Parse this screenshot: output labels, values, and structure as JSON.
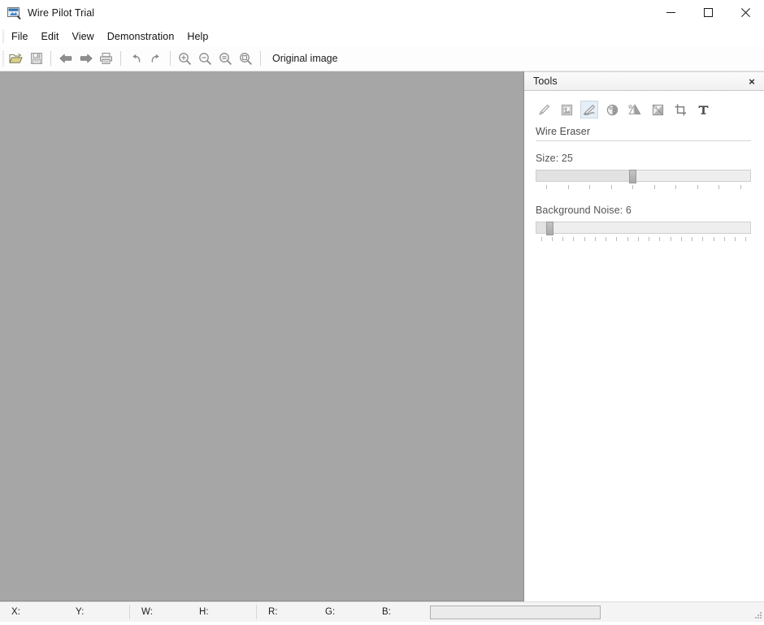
{
  "window": {
    "title": "Wire Pilot Trial",
    "icon": "app-icon",
    "controls": {
      "minimize": "minimize-icon",
      "maximize": "maximize-icon",
      "close": "close-icon"
    }
  },
  "menubar": {
    "items": [
      {
        "label": "File"
      },
      {
        "label": "Edit"
      },
      {
        "label": "View"
      },
      {
        "label": "Demonstration"
      },
      {
        "label": "Help"
      }
    ]
  },
  "toolbar": {
    "buttons": [
      {
        "name": "open-icon",
        "title": "Open"
      },
      {
        "name": "save-icon",
        "title": "Save"
      },
      {
        "name": "back-arrow-icon",
        "title": "Back"
      },
      {
        "name": "forward-arrow-icon",
        "title": "Forward"
      },
      {
        "name": "print-icon",
        "title": "Print"
      },
      {
        "name": "undo-icon",
        "title": "Undo"
      },
      {
        "name": "redo-icon",
        "title": "Redo"
      },
      {
        "name": "zoom-in-icon",
        "title": "Zoom In"
      },
      {
        "name": "zoom-out-icon",
        "title": "Zoom Out"
      },
      {
        "name": "zoom-fit-icon",
        "title": "Fit To Window"
      },
      {
        "name": "zoom-actual-icon",
        "title": "Actual Size"
      }
    ],
    "original_image_label": "Original image"
  },
  "tools_panel": {
    "title": "Tools",
    "close_label": "×",
    "tools": [
      {
        "name": "pencil-icon",
        "label": "Pencil"
      },
      {
        "name": "stamp-icon",
        "label": "Stamp"
      },
      {
        "name": "wire-eraser-icon",
        "label": "Wire Eraser"
      },
      {
        "name": "color-wheel-icon",
        "label": "Color"
      },
      {
        "name": "mirror-icon",
        "label": "Mirror"
      },
      {
        "name": "gradient-icon",
        "label": "Gradient"
      },
      {
        "name": "crop-icon",
        "label": "Crop"
      },
      {
        "name": "text-icon",
        "label": "T"
      }
    ],
    "active_tool": "wire-eraser-icon",
    "section_title": "Wire Eraser",
    "sliders": [
      {
        "name": "size-slider",
        "label": "Size: 25",
        "value": 25,
        "min": 1,
        "max": 55,
        "percent": 45,
        "ticks": 10
      },
      {
        "name": "background-noise-slider",
        "label": "Background Noise: 6",
        "value": 6,
        "min": 0,
        "max": 100,
        "percent": 6,
        "ticks": 20
      }
    ]
  },
  "canvas": {
    "name": "image-canvas",
    "background_color": "#a6a6a6"
  },
  "statusbar": {
    "fields": [
      {
        "name": "status-x",
        "label": "X:",
        "value": ""
      },
      {
        "name": "status-y",
        "label": "Y:",
        "value": ""
      },
      {
        "name": "status-w",
        "label": "W:",
        "value": ""
      },
      {
        "name": "status-h",
        "label": "H:",
        "value": ""
      },
      {
        "name": "status-r",
        "label": "R:",
        "value": ""
      },
      {
        "name": "status-g",
        "label": "G:",
        "value": ""
      },
      {
        "name": "status-b",
        "label": "B:",
        "value": ""
      }
    ],
    "progress_value": 0
  }
}
